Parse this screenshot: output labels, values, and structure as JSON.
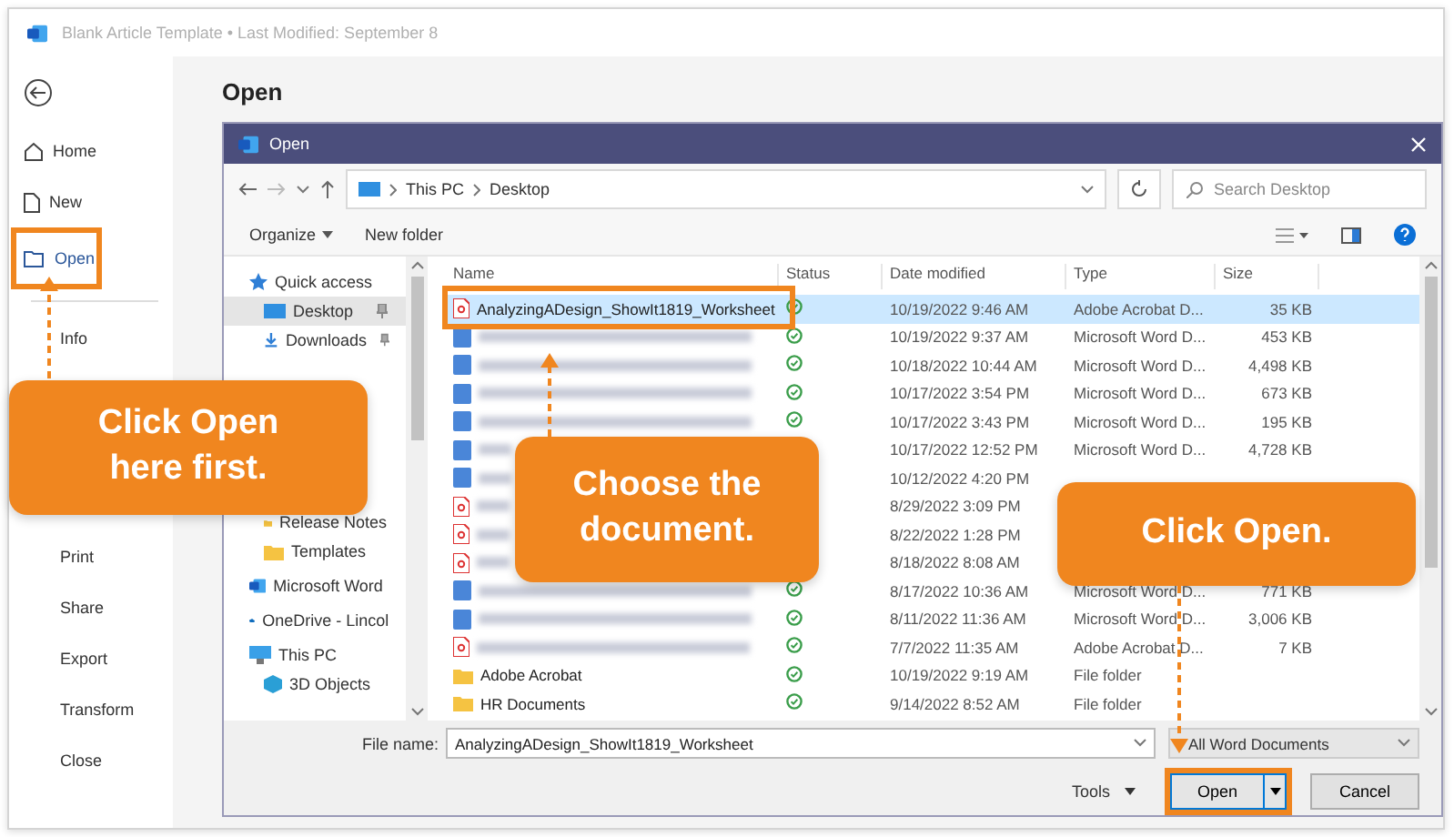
{
  "window": {
    "title": "Blank Article Template • Last Modified: September 8"
  },
  "backstage": {
    "heading": "Open",
    "nav_top": [
      {
        "label": "Home",
        "selected": false,
        "highlighted": false
      },
      {
        "label": "New",
        "selected": false,
        "highlighted": false
      },
      {
        "label": "Open",
        "selected": true,
        "highlighted": true
      }
    ],
    "nav_middle": [
      {
        "label": "Info"
      }
    ],
    "nav_bottom": [
      {
        "label": "Print"
      },
      {
        "label": "Share"
      },
      {
        "label": "Export"
      },
      {
        "label": "Transform"
      },
      {
        "label": "Close"
      }
    ]
  },
  "dialog": {
    "title": "Open",
    "address": {
      "path": [
        "This PC",
        "Desktop"
      ],
      "search_placeholder": "Search Desktop"
    },
    "toolbar": {
      "organize": "Organize",
      "new_folder": "New folder"
    },
    "nav": [
      {
        "label": "Quick access",
        "kind": "star",
        "selected": false,
        "children": [
          {
            "label": "Desktop",
            "kind": "desktop",
            "selected": true,
            "pinned": true
          },
          {
            "label": "Downloads",
            "kind": "download",
            "selected": false,
            "pinned": true
          },
          {
            "label": "Release Notes",
            "kind": "folder",
            "selected": false,
            "pinned": false
          },
          {
            "label": "Templates",
            "kind": "folder",
            "selected": false,
            "pinned": false
          }
        ]
      },
      {
        "label": "Microsoft Word",
        "kind": "word",
        "selected": false
      },
      {
        "label": "OneDrive - Lincol",
        "kind": "cloud",
        "selected": false
      },
      {
        "label": "This PC",
        "kind": "pc",
        "selected": false,
        "children": [
          {
            "label": "3D Objects",
            "kind": "cube",
            "selected": false,
            "pinned": false
          }
        ]
      }
    ],
    "columns": [
      "Name",
      "Status",
      "Date modified",
      "Type",
      "Size"
    ],
    "rows": [
      {
        "kind": "pdf",
        "name": "AnalyzingADesign_ShowIt1819_Worksheet",
        "synced": true,
        "selected": true,
        "highlighted": true,
        "date": "10/19/2022 9:46 AM",
        "type": "Adobe Acrobat D...",
        "size": "35 KB"
      },
      {
        "kind": "word",
        "synced": true,
        "selected": false,
        "highlighted": false,
        "date": "10/19/2022 9:37 AM",
        "type": "Microsoft Word D...",
        "size": "453 KB"
      },
      {
        "kind": "word",
        "synced": true,
        "selected": false,
        "highlighted": false,
        "date": "10/18/2022 10:44 AM",
        "type": "Microsoft Word D...",
        "size": "4,498 KB"
      },
      {
        "kind": "word",
        "synced": true,
        "selected": false,
        "highlighted": false,
        "date": "10/17/2022 3:54 PM",
        "type": "Microsoft Word D...",
        "size": "673 KB"
      },
      {
        "kind": "word",
        "synced": true,
        "selected": false,
        "highlighted": false,
        "date": "10/17/2022 3:43 PM",
        "type": "Microsoft Word D...",
        "size": "195 KB"
      },
      {
        "kind": "word",
        "selected": false,
        "highlighted": false,
        "date": "10/17/2022 12:52 PM",
        "type": "Microsoft Word D...",
        "size": "4,728 KB"
      },
      {
        "kind": "word",
        "selected": false,
        "highlighted": false,
        "date": "10/12/2022 4:20 PM"
      },
      {
        "kind": "pdf",
        "selected": false,
        "highlighted": false,
        "date": "8/29/2022 3:09 PM"
      },
      {
        "kind": "pdf",
        "selected": false,
        "highlighted": false,
        "date": "8/22/2022 1:28 PM"
      },
      {
        "kind": "pdf",
        "selected": false,
        "highlighted": false,
        "date": "8/18/2022 8:08 AM"
      },
      {
        "kind": "word",
        "synced": true,
        "selected": false,
        "highlighted": false,
        "date": "8/17/2022 10:36 AM",
        "type": "Microsoft Word D...",
        "size": "771 KB"
      },
      {
        "kind": "word",
        "synced": true,
        "selected": false,
        "highlighted": false,
        "date": "8/11/2022 11:36 AM",
        "type": "Microsoft Word D...",
        "size": "3,006 KB"
      },
      {
        "kind": "pdf",
        "synced": true,
        "selected": false,
        "highlighted": false,
        "date": "7/7/2022 11:35 AM",
        "type": "Adobe Acrobat D...",
        "size": "7 KB"
      },
      {
        "kind": "folder",
        "name": "Adobe Acrobat",
        "synced": true,
        "selected": false,
        "highlighted": false,
        "date": "10/19/2022 9:19 AM",
        "type": "File folder"
      },
      {
        "kind": "folder",
        "name": "HR Documents",
        "synced": true,
        "selected": false,
        "highlighted": false,
        "date": "9/14/2022 8:52 AM",
        "type": "File folder"
      }
    ],
    "file_name_label": "File name:",
    "file_name": "AnalyzingADesign_ShowIt1819_Worksheet",
    "file_type": "All Word Documents",
    "tools": "Tools",
    "open_button": {
      "label": "Open",
      "highlighted": true
    },
    "cancel": "Cancel"
  },
  "callouts": [
    {
      "lines": [
        "Click Open",
        "here first."
      ]
    },
    {
      "lines": [
        "Choose the",
        "document."
      ]
    },
    {
      "lines": [
        "Click Open."
      ]
    }
  ]
}
